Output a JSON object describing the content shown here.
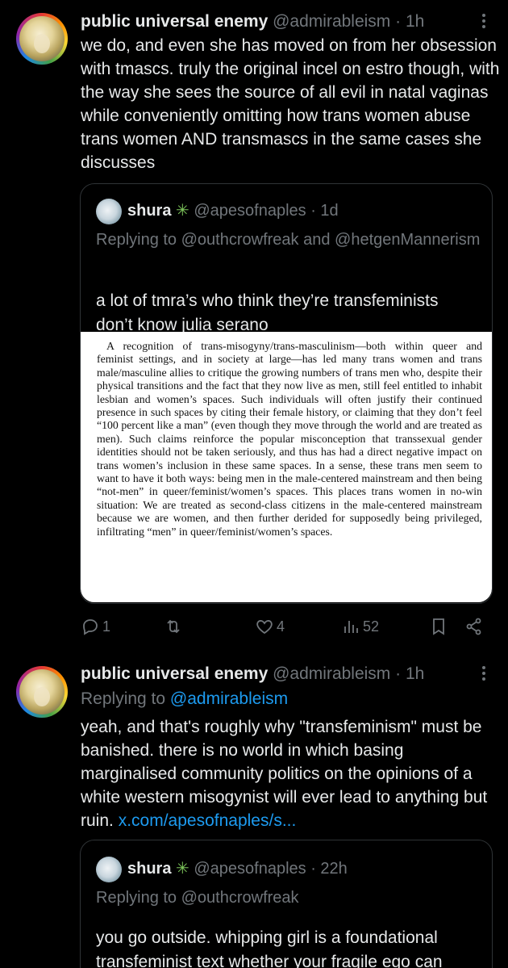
{
  "tweets": [
    {
      "author_name": "public universal enemy",
      "author_handle": "@admirableism",
      "time": "· 1h",
      "text": "we do, and even she has moved on from her obsession with tmascs. truly the original incel on estro though, with the way she sees the source of all evil in natal vaginas while conveniently omitting how trans women abuse trans women AND transmascs in the same cases she discusses",
      "quote": {
        "author_name": "shura",
        "badge_icon": "sparkle",
        "author_handle": "@apesofnaples",
        "time": "· 1d",
        "replying_to": "Replying to @outhcrowfreak and @hetgenMannerism",
        "text": "a lot of tmra’s who think they’re transfeminists don’t know julia serano",
        "image_text": "A recognition of trans-misogyny/trans-masculinism—both within queer and feminist settings, and in society at large—has led many trans women and trans male/masculine allies to critique the growing numbers of trans men who, despite their physical transitions and the fact that they now live as men, still feel entitled to inhabit lesbian and women’s spaces. Such individuals will often justify their continued presence in such spaces by citing their female history, or claiming that they don’t feel “100 percent like a man” (even though they move through the world and are treated as men). Such claims reinforce the popular misconception that transsexual gender identities should not be taken seriously, and thus has had a direct negative impact on trans women’s inclusion in these same spaces. In a sense, these trans men seem to want to have it both ways: being men in the male-centered mainstream and then being “not-men” in queer/feminist/women’s spaces. This places trans women in no-win situation: We are treated as second-class citizens in the male-centered mainstream because we are women, and then further derided for supposedly being privileged, infiltrating “men” in queer/feminist/women’s spaces."
      },
      "actions": {
        "reply_count": "1",
        "retweet_count": "",
        "like_count": "4",
        "view_count": "52"
      }
    },
    {
      "author_name": "public universal enemy",
      "author_handle": "@admirableism",
      "time": "· 1h",
      "replying_to_label": "Replying to",
      "replying_to_handle": "@admirableism",
      "text": "yeah, and that's roughly why \"transfeminism\" must be banished. there is no world in which basing marginalised community politics on the opinions of a white western misogynist will ever lead to anything but ruin.",
      "link": "x.com/apesofnaples/s...",
      "quote": {
        "author_name": "shura",
        "badge_icon": "sparkle",
        "author_handle": "@apesofnaples",
        "time": "· 22h",
        "replying_to": "Replying to @outhcrowfreak",
        "text": "you go outside. whipping girl is a foundational transfeminist text whether your fragile ego can"
      }
    }
  ],
  "colors": {
    "background": "#000000",
    "text": "#e7e9ea",
    "muted": "#71767b",
    "link": "#1d9bf0",
    "border": "#2f3336",
    "badge": "#7cc35a"
  }
}
